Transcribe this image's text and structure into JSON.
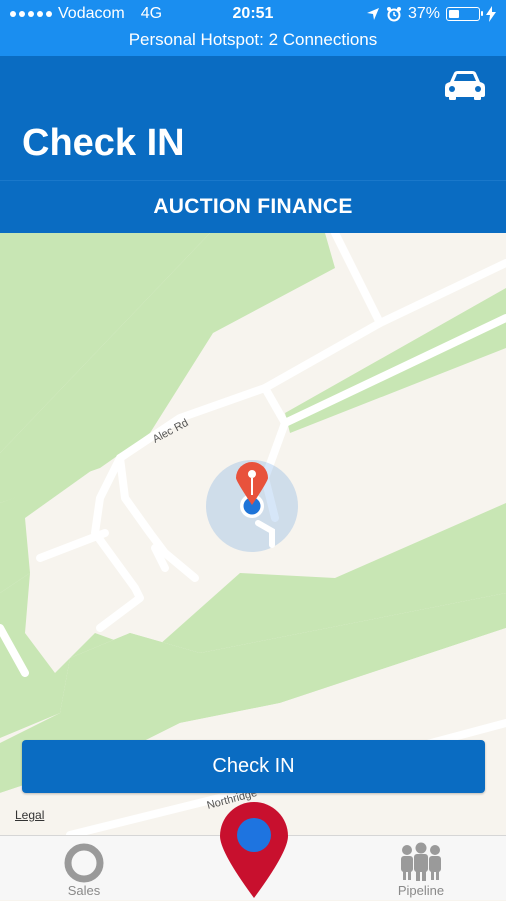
{
  "status_bar": {
    "carrier": "Vodacom",
    "network": "4G",
    "time": "20:51",
    "battery": "37%",
    "battery_level": 0.37,
    "hotspot": "Personal Hotspot: 2 Connections"
  },
  "header": {
    "title": "Check IN",
    "subtitle": "AUCTION FINANCE",
    "action_icon": "car-icon"
  },
  "map": {
    "street_labels": [
      "Alec Rd",
      "Northridge"
    ],
    "legal_label": "Legal",
    "colors": {
      "land": "#f7f4ee",
      "park": "#c8e6b4",
      "road": "#ffffff",
      "pin": "#e8523c",
      "location": "#1e74d8"
    }
  },
  "checkin_button": {
    "label": "Check IN"
  },
  "tab_bar": {
    "items": [
      {
        "label": "Sales",
        "icon": "ring-icon"
      },
      {
        "label": "",
        "icon": "location-pin-icon"
      },
      {
        "label": "Pipeline",
        "icon": "people-icon"
      }
    ],
    "center_color": "#c8102e"
  }
}
